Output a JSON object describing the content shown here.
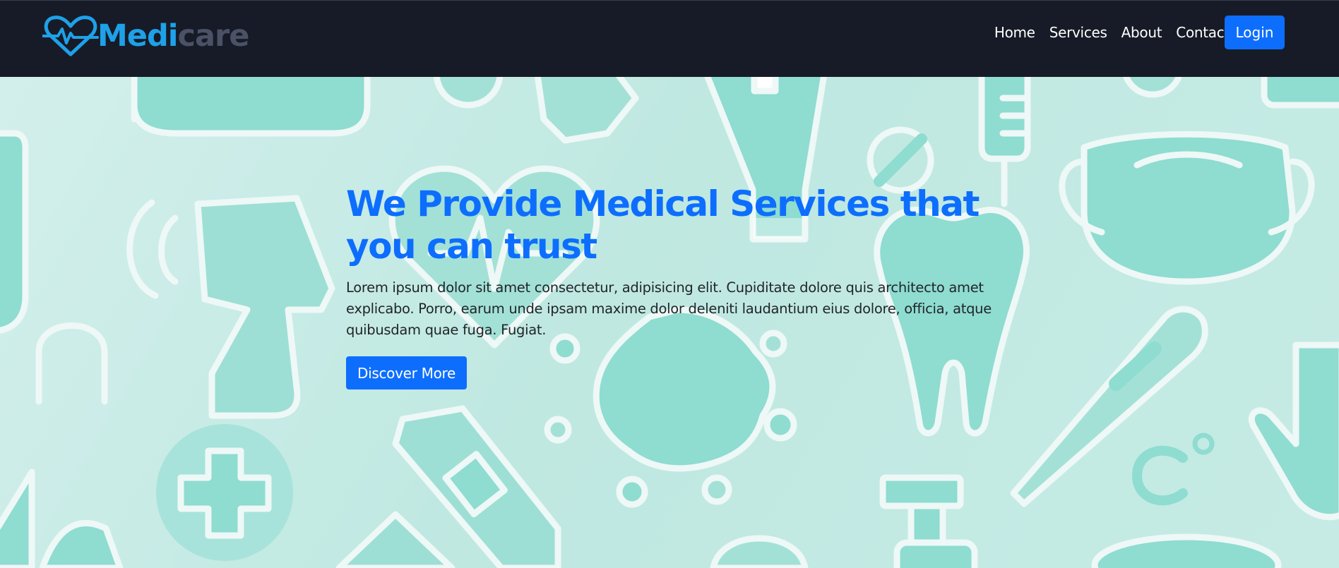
{
  "brand": {
    "name_part1": "Medi",
    "name_part2": "care",
    "logo_icon": "heart-pulse-icon",
    "color_primary": "#1ea1e8",
    "color_secondary": "#4b5266"
  },
  "nav": {
    "items": [
      {
        "label": "Home"
      },
      {
        "label": "Services"
      },
      {
        "label": "About"
      },
      {
        "label": "Contact"
      }
    ],
    "login_label": "Login"
  },
  "hero": {
    "title": "We Provide Medical Services that you can trust",
    "description": "Lorem ipsum dolor sit amet consectetur, adipisicing elit. Cupiditate dolore quis architecto amet explicabo. Porro, earum unde ipsam maxime dolor deleniti laudantium eius dolore, officia, atque quibusdam quae fuga. Fugiat.",
    "cta_label": "Discover More",
    "background_icons": [
      "face-mask-icon",
      "heart-icon",
      "thermometer-gun-icon",
      "virus-icon",
      "tooth-icon",
      "bandage-icon",
      "cross-icon",
      "pill-icon",
      "syringe-icon",
      "glove-icon",
      "celsius-icon",
      "soap-bottle-icon",
      "lungs-icon"
    ]
  },
  "colors": {
    "navbar_bg": "#171b27",
    "accent": "#0d6efd",
    "hero_bg": "#c4ebe4",
    "icon_fill": "#8fdcd1",
    "icon_outline": "#eef8f6"
  }
}
